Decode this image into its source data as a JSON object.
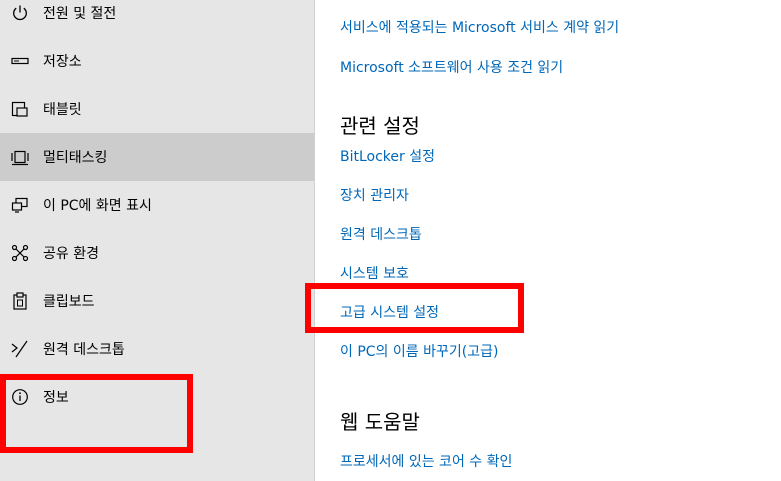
{
  "sidebar": {
    "items": [
      {
        "label": "전원 및 절전",
        "icon": "power-icon"
      },
      {
        "label": "저장소",
        "icon": "storage-drive-icon"
      },
      {
        "label": "태블릿",
        "icon": "tablet-icon"
      },
      {
        "label": "멀티태스킹",
        "icon": "multitasking-icon",
        "selected": true
      },
      {
        "label": "이 PC에 화면 표시",
        "icon": "project-to-pc-icon"
      },
      {
        "label": "공유 환경",
        "icon": "shared-experiences-icon"
      },
      {
        "label": "클립보드",
        "icon": "clipboard-icon"
      },
      {
        "label": "원격 데스크톱",
        "icon": "remote-desktop-icon"
      },
      {
        "label": "정보",
        "icon": "info-icon"
      }
    ]
  },
  "main": {
    "top_links": [
      "서비스에 적용되는 Microsoft 서비스 계약 읽기",
      "Microsoft 소프트웨어 사용 조건 읽기"
    ],
    "related_settings": {
      "title": "관련 설정",
      "links": [
        "BitLocker 설정",
        "장치 관리자",
        "원격 데스크톱",
        "시스템 보호",
        "고급 시스템 설정",
        "이 PC의 이름 바꾸기(고급)"
      ]
    },
    "web_help": {
      "title": "웹 도움말",
      "links": [
        "프로세서에 있는 코어 수 확인"
      ]
    }
  },
  "colors": {
    "sidebar_bg": "#e6e6e6",
    "selected_bg": "#cccccc",
    "link": "#0067b8",
    "highlight": "#ff0000"
  }
}
